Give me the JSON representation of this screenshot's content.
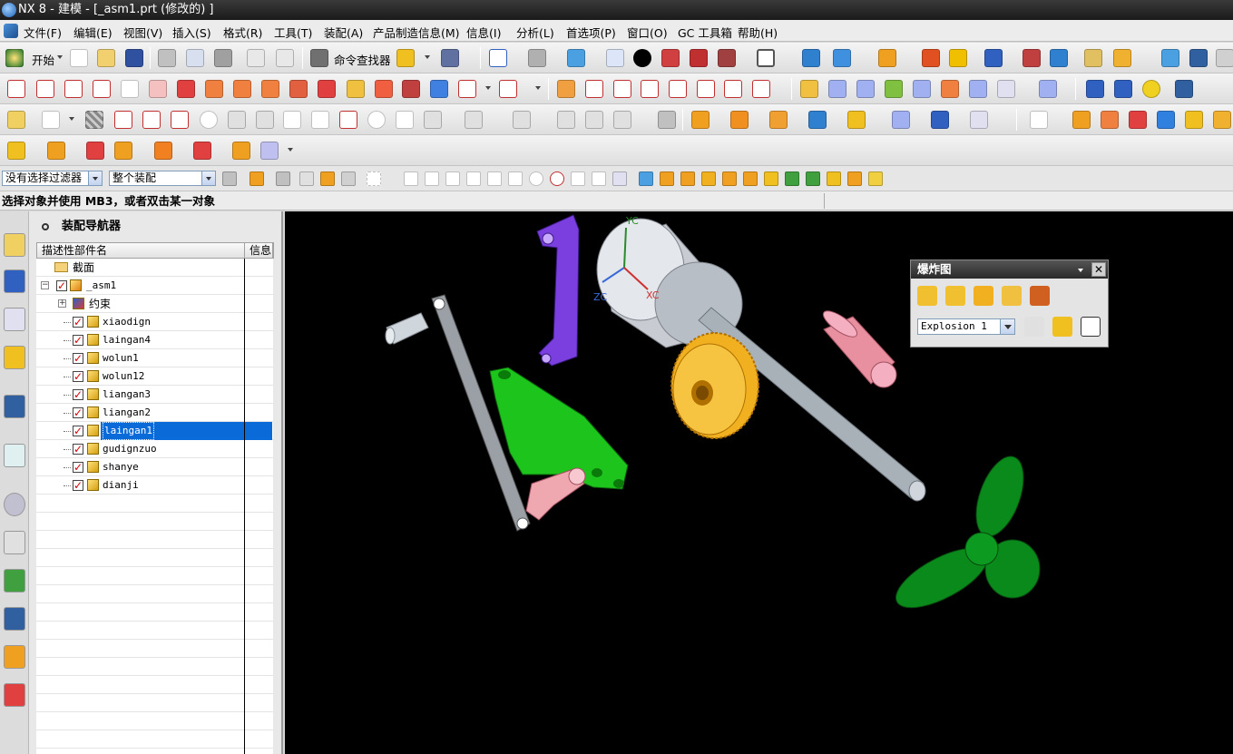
{
  "window": {
    "title": "NX 8 - 建模 - [_asm1.prt  (修改的) ]"
  },
  "menu": [
    "文件(F)",
    "编辑(E)",
    "视图(V)",
    "插入(S)",
    "格式(R)",
    "工具(T)",
    "装配(A)",
    "产品制造信息(M)",
    "信息(I)",
    "分析(L)",
    "首选项(P)",
    "窗口(O)",
    "GC 工具箱",
    "帮助(H)"
  ],
  "toolbar": {
    "start_label": "开始",
    "command_finder_label": "命令查找器"
  },
  "selection": {
    "filter": "没有选择过滤器",
    "scope": "整个装配"
  },
  "status": {
    "prompt": "选择对象并使用 MB3，或者双击某一对象"
  },
  "navigator": {
    "title": "装配导航器",
    "col_name": "描述性部件名",
    "col_info": "信息",
    "section_label": "截面",
    "root": "_asm1",
    "constraints": "约束",
    "parts": [
      "xiaodign",
      "laingan4",
      "wolun1",
      "wolun12",
      "liangan3",
      "liangan2",
      "laingan1",
      "gudignzuo",
      "shanye",
      "dianji"
    ],
    "selected_part": "laingan1"
  },
  "viewport": {
    "axis_labels": [
      "YC",
      "ZC",
      "XC"
    ]
  },
  "explosion_dialog": {
    "title": "爆炸图",
    "selected_explosion": "Explosion 1"
  },
  "colors": {
    "viewport_bg": "#000000",
    "selection": "#0a6ad8",
    "gear": "#f0b020",
    "bracket": "#1cc41c",
    "lever": "#7b3fe0",
    "worm": "#f5a0b0"
  }
}
